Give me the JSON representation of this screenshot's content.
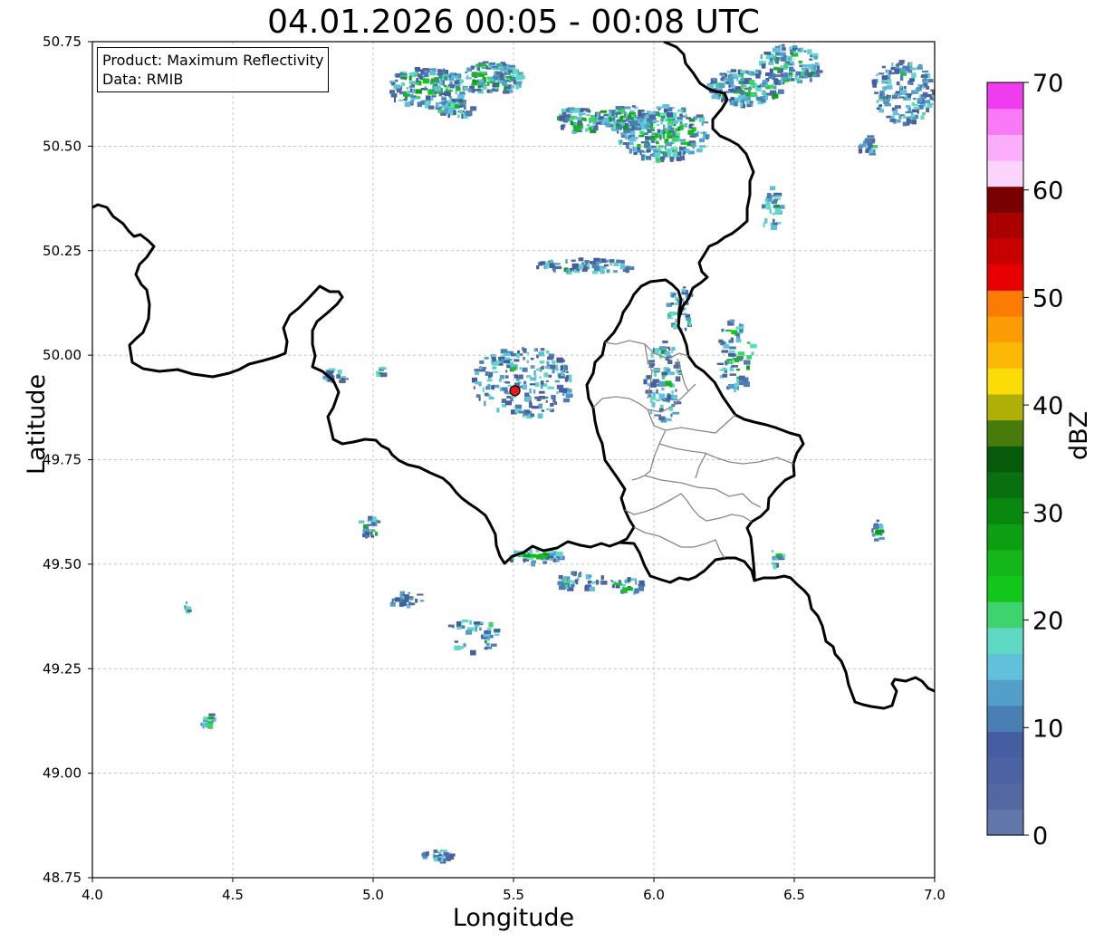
{
  "title": "04.01.2026 00:05 - 00:08 UTC",
  "info_box": {
    "product": "Product: Maximum Reflectivity",
    "data": "Data: RMIB"
  },
  "axes": {
    "xlabel": "Longitude",
    "ylabel": "Latitude",
    "x_range": [
      4.0,
      7.0
    ],
    "y_range": [
      48.75,
      50.75
    ],
    "x_ticks": [
      "4.0",
      "4.5",
      "5.0",
      "5.5",
      "6.0",
      "6.5",
      "7.0"
    ],
    "y_ticks": [
      "48.75",
      "49.00",
      "49.25",
      "49.50",
      "49.75",
      "50.00",
      "50.25",
      "50.50",
      "50.75"
    ],
    "grid": true
  },
  "colorbar": {
    "label": "dBZ",
    "ticks": [
      "0",
      "10",
      "20",
      "30",
      "40",
      "50",
      "60",
      "70"
    ],
    "colors": [
      "#6177a9",
      "#5367a1",
      "#4b63a2",
      "#445ea1",
      "#4a7fb5",
      "#539fc9",
      "#62c1da",
      "#5fd8c4",
      "#3ed36c",
      "#12c61c",
      "#15b61a",
      "#0d9f12",
      "#09870e",
      "#097010",
      "#065a0a",
      "#477c0c",
      "#afb007",
      "#fbdc06",
      "#fcb804",
      "#fc9c04",
      "#fc7b03",
      "#e80000",
      "#c90000",
      "#aa0000",
      "#7a0000",
      "#fcd5fd",
      "#fcadfc",
      "#f979f7",
      "#ee3cee"
    ]
  },
  "radar_site": {
    "lon": 5.505,
    "lat": 49.915,
    "color": "#e41a1c"
  }
}
